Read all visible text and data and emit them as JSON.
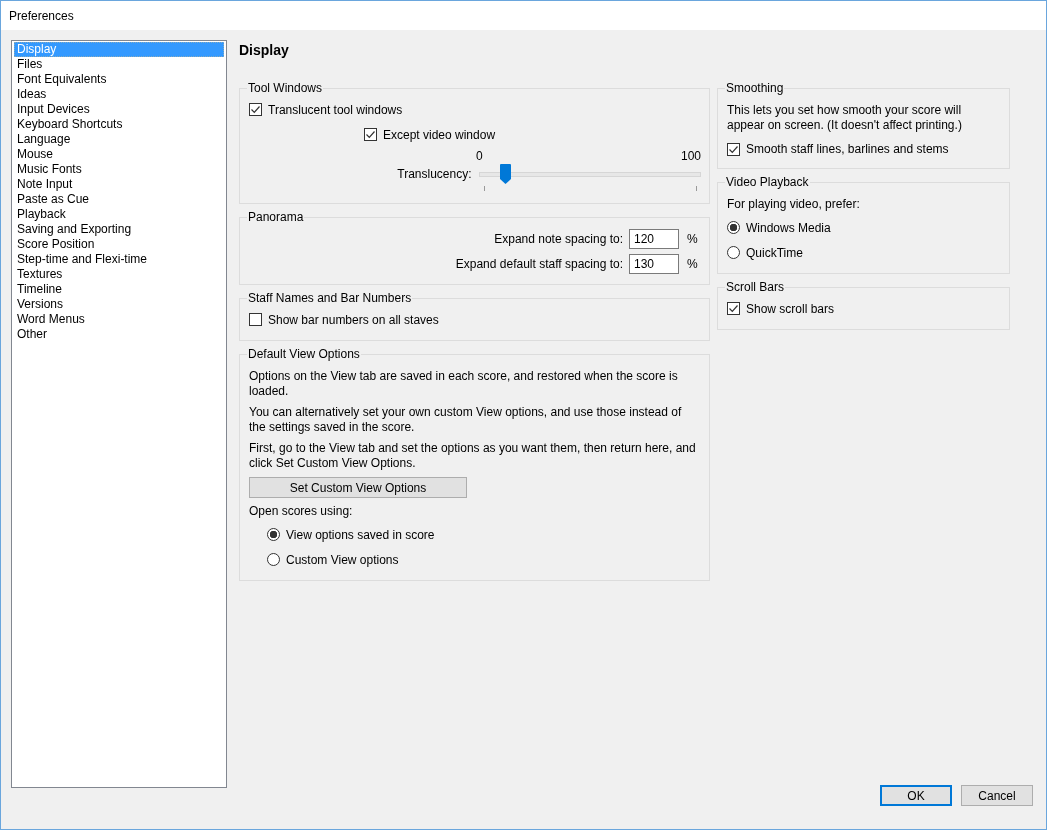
{
  "window": {
    "title": "Preferences"
  },
  "sidebar": {
    "items": [
      {
        "label": "Display",
        "selected": true
      },
      {
        "label": "Files",
        "selected": false
      },
      {
        "label": "Font Equivalents",
        "selected": false
      },
      {
        "label": "Ideas",
        "selected": false
      },
      {
        "label": "Input Devices",
        "selected": false
      },
      {
        "label": "Keyboard Shortcuts",
        "selected": false
      },
      {
        "label": "Language",
        "selected": false
      },
      {
        "label": "Mouse",
        "selected": false
      },
      {
        "label": "Music Fonts",
        "selected": false
      },
      {
        "label": "Note Input",
        "selected": false
      },
      {
        "label": "Paste as Cue",
        "selected": false
      },
      {
        "label": "Playback",
        "selected": false
      },
      {
        "label": "Saving and Exporting",
        "selected": false
      },
      {
        "label": "Score Position",
        "selected": false
      },
      {
        "label": "Step-time and Flexi-time",
        "selected": false
      },
      {
        "label": "Textures",
        "selected": false
      },
      {
        "label": "Timeline",
        "selected": false
      },
      {
        "label": "Versions",
        "selected": false
      },
      {
        "label": "Word Menus",
        "selected": false
      },
      {
        "label": "Other",
        "selected": false
      }
    ]
  },
  "page_title": "Display",
  "tool_windows": {
    "title": "Tool Windows",
    "translucent": {
      "label": "Translucent tool windows",
      "checked": true
    },
    "except_video": {
      "label": "Except video window",
      "checked": true
    },
    "slider": {
      "label": "Translucency:",
      "min_label": "0",
      "max_label": "100",
      "level": 0.12
    }
  },
  "panorama": {
    "title": "Panorama",
    "fields": [
      {
        "label": "Expand note spacing to:",
        "value": "120",
        "unit": "%"
      },
      {
        "label": "Expand default staff spacing to:",
        "value": "130",
        "unit": "%"
      }
    ]
  },
  "staff_names": {
    "title": "Staff Names and Bar Numbers",
    "checkboxes": [
      {
        "label": "Show bar numbers on all staves",
        "checked": false
      }
    ]
  },
  "default_view": {
    "title": "Default View Options",
    "paragraphs": [
      "Options on the View tab are saved in each score, and restored when the score is loaded.",
      "You can alternatively set your own custom View options, and use those instead of the settings saved in the score.",
      "First, go to the View tab and set the options as you want them, then return here, and click Set Custom View Options."
    ],
    "button": "Set Custom View Options",
    "open_label": "Open scores using:",
    "options": [
      {
        "label": "View options saved in score",
        "selected": true
      },
      {
        "label": "Custom View options",
        "selected": false
      }
    ]
  },
  "smoothing": {
    "title": "Smoothing",
    "description": "This lets you set how smooth your score will appear on screen. (It doesn't affect printing.)",
    "checkboxes": [
      {
        "label": "Smooth staff lines, barlines and stems",
        "checked": true
      }
    ]
  },
  "video_playback": {
    "title": "Video Playback",
    "prompt": "For playing video, prefer:",
    "options": [
      {
        "label": "Windows Media",
        "selected": true
      },
      {
        "label": "QuickTime",
        "selected": false
      }
    ]
  },
  "scroll_bars": {
    "title": "Scroll Bars",
    "checkboxes": [
      {
        "label": "Show scroll bars",
        "checked": true
      }
    ]
  },
  "buttons": [
    {
      "label": "OK",
      "default": true
    },
    {
      "label": "Cancel",
      "default": false
    }
  ]
}
